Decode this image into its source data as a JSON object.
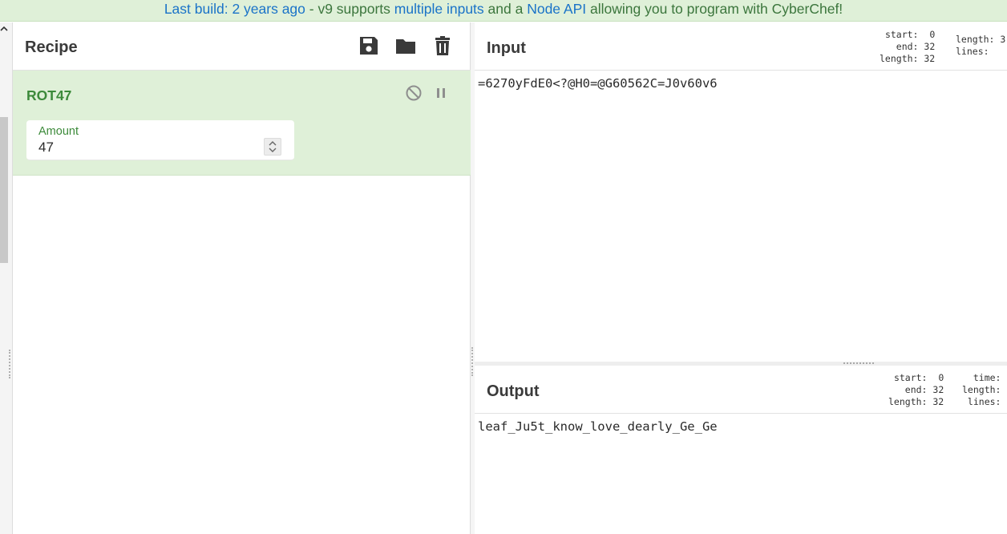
{
  "banner": {
    "prefix": "Last build: 2 years ago",
    "sep": " - v9 supports ",
    "link1": "multiple inputs",
    "mid": " and a ",
    "link2": "Node API",
    "suffix": " allowing you to program with CyberChef!"
  },
  "recipe": {
    "title": "Recipe",
    "icons": [
      "save-icon",
      "folder-open-icon",
      "trash-icon"
    ],
    "operation": {
      "name": "ROT47",
      "arg_label": "Amount",
      "arg_value": "47"
    }
  },
  "input": {
    "title": "Input",
    "text": "=6270yFdE0<?@H0=@G60562C=J0v60v6",
    "sel": "start:  0\n  end: 32\nlength: 32",
    "info": "length: 3\nlines:  "
  },
  "output": {
    "title": "Output",
    "text": "leaf_Ju5t_know_love_dearly_Ge_Ge",
    "sel": "start:  0\n  end: 32\nlength: 32",
    "info": "time:\nlength:\nlines:"
  },
  "colors": {
    "banner_bg": "#dff0d8",
    "accent_green": "#3c8a3a",
    "link_blue": "#1a73c8"
  }
}
